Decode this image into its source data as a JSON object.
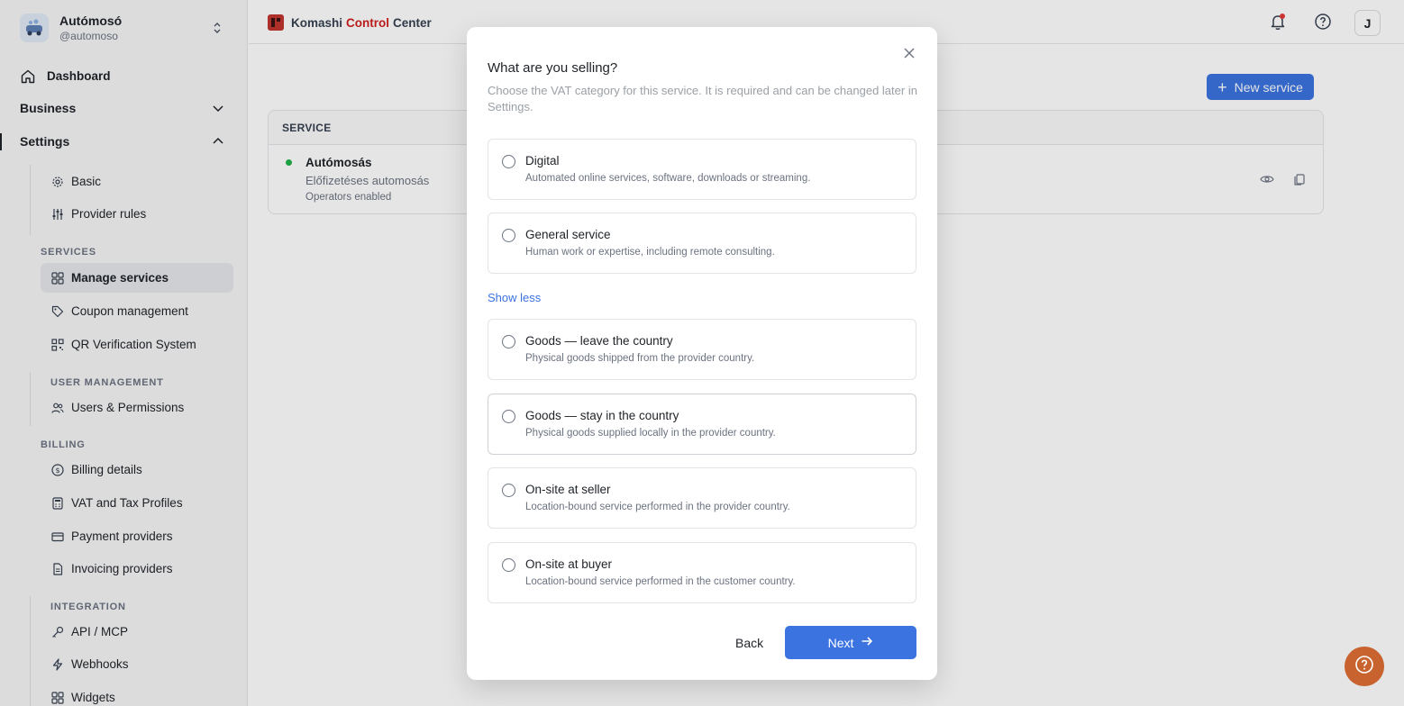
{
  "org": {
    "name": "Autómosó",
    "handle": "@automoso"
  },
  "nav": {
    "dashboard": "Dashboard",
    "business": "Business",
    "settings": "Settings",
    "basic": "Basic",
    "provider_rules": "Provider rules",
    "services_label": "SERVICES",
    "manage_services": "Manage services",
    "coupon_management": "Coupon management",
    "qr_verification": "QR Verification System",
    "user_management_label": "USER MANAGEMENT",
    "users_permissions": "Users & Permissions",
    "billing_label": "BILLING",
    "billing_details": "Billing details",
    "vat_tax": "VAT and Tax Profiles",
    "payment_providers": "Payment providers",
    "invoicing_providers": "Invoicing providers",
    "integration_label": "INTEGRATION",
    "api_mcp": "API / MCP",
    "webhooks": "Webhooks",
    "widgets": "Widgets"
  },
  "topbar": {
    "brand_part1": "Komashi",
    "brand_part2": "Control",
    "brand_part3": "Center",
    "user_initial": "J"
  },
  "main": {
    "new_service_label": "New service",
    "table_header": "SERVICE",
    "service": {
      "name": "Autómosás",
      "subtitle": "Előfizetéses automosás",
      "status": "Operators enabled"
    }
  },
  "modal": {
    "title": "What are you selling?",
    "description": "Choose the VAT category for this service. It is required and can be changed later in Settings.",
    "options": [
      {
        "title": "Digital",
        "desc": "Automated online services, software, downloads or streaming."
      },
      {
        "title": "General service",
        "desc": "Human work or expertise, including remote consulting."
      },
      {
        "title": "Goods — leave the country",
        "desc": "Physical goods shipped from the provider country."
      },
      {
        "title": "Goods — stay in the country",
        "desc": "Physical goods supplied locally in the provider country."
      },
      {
        "title": "On-site at seller",
        "desc": "Location-bound service performed in the provider country."
      },
      {
        "title": "On-site at buyer",
        "desc": "Location-bound service performed in the customer country."
      }
    ],
    "show_less": "Show less",
    "back_label": "Back",
    "next_label": "Next"
  },
  "colors": {
    "primary": "#3b73e0",
    "brand_red": "#d01f1f",
    "help_fab": "#c8622e",
    "status_green": "#21b24b"
  }
}
